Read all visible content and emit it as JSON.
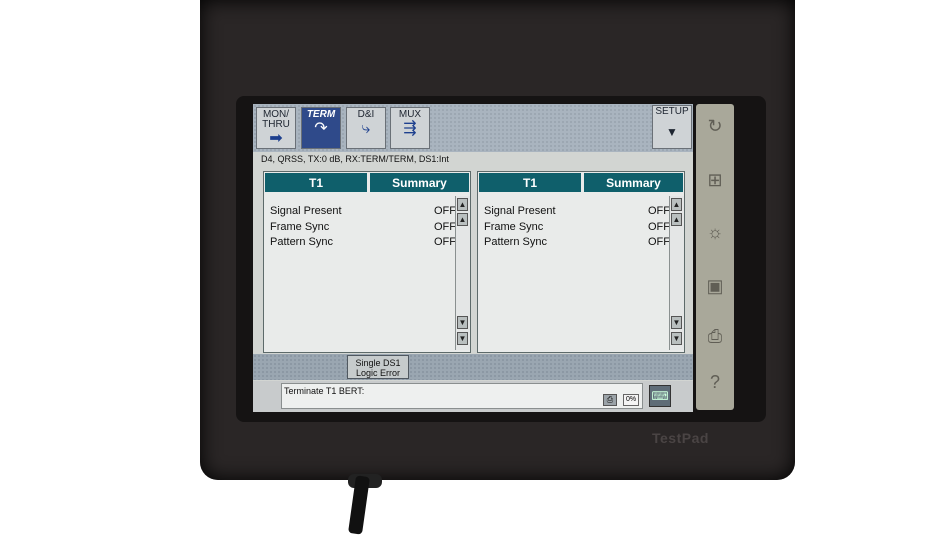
{
  "toolbar": {
    "tabs": [
      {
        "label": "MON/\nTHRU",
        "icon": "arrow-right-icon"
      },
      {
        "label": "TERM",
        "icon": "loop-arrow-icon"
      },
      {
        "label": "D&I",
        "icon": "drop-insert-icon"
      },
      {
        "label": "MUX",
        "icon": "mux-icon"
      }
    ],
    "setup_label": "SETUP",
    "setup_icon": "triangle-down-icon"
  },
  "status_line": "D4, QRSS, TX:0 dB, RX:TERM/TERM, DS1:Int",
  "panels": [
    {
      "header_left": "T1",
      "header_right": "Summary",
      "rows": [
        {
          "label": "Signal Present",
          "value": "OFF"
        },
        {
          "label": "Frame Sync",
          "value": "OFF"
        },
        {
          "label": "Pattern Sync",
          "value": "OFF"
        }
      ]
    },
    {
      "header_left": "T1",
      "header_right": "Summary",
      "rows": [
        {
          "label": "Signal Present",
          "value": "OFF"
        },
        {
          "label": "Frame Sync",
          "value": "OFF"
        },
        {
          "label": "Pattern Sync",
          "value": "OFF"
        }
      ]
    }
  ],
  "action_button": "Single DS1\nLogic Error",
  "message": "Terminate T1 BERT:",
  "battery_percent": "0%",
  "brand": "TestPad",
  "colors": {
    "accent": "#0f5f6b",
    "active_tab": "#2f4a8a"
  }
}
